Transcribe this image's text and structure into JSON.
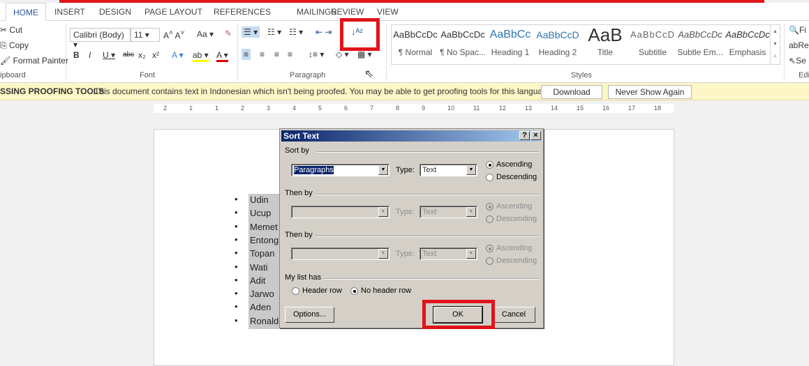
{
  "tabs": [
    "HOME",
    "INSERT",
    "DESIGN",
    "PAGE LAYOUT",
    "REFERENCES",
    "MAILINGS",
    "REVIEW",
    "VIEW"
  ],
  "clipboard": {
    "cut": "Cut",
    "copy": "Copy",
    "format_painter": "Format Painter",
    "group": "ipboard"
  },
  "font": {
    "name": "Calibri (Body)",
    "size": "11",
    "group": "Font",
    "case": "Aa"
  },
  "paragraph": {
    "group": "Paragraph",
    "sort_icon": "A-Z sort"
  },
  "styles": {
    "group": "Styles",
    "items": [
      {
        "preview": "AaBbCcDc",
        "name": "¶ Normal"
      },
      {
        "preview": "AaBbCcDc",
        "name": "¶ No Spac..."
      },
      {
        "preview": "AaBbCc",
        "name": "Heading 1"
      },
      {
        "preview": "AaBbCcD",
        "name": "Heading 2"
      },
      {
        "preview": "AaB",
        "name": "Title"
      },
      {
        "preview": "AaBbCcD",
        "name": "Subtitle"
      },
      {
        "preview": "AaBbCcDc",
        "name": "Subtle Em..."
      },
      {
        "preview": "AaBbCcDc",
        "name": "Emphasis"
      }
    ]
  },
  "editing": {
    "find": "Fi",
    "replace": "Re",
    "select": "Se",
    "group": "Edi"
  },
  "message_bar": {
    "title": "SSING PROOFING TOOLS",
    "text": "This document contains text in Indonesian which isn't being proofed. You may be able to get proofing tools for this language.",
    "download": "Download",
    "never": "Never Show Again"
  },
  "ruler": [
    "2",
    "1",
    "1",
    "2",
    "3",
    "4",
    "5",
    "6",
    "7",
    "8",
    "9",
    "10",
    "11",
    "12",
    "13",
    "14",
    "15",
    "16",
    "17",
    "18"
  ],
  "list": [
    "Udin",
    "Ucup",
    "Memet",
    "Entong",
    "Topan",
    "Wati",
    "Adit",
    "Jarwo",
    "Aden",
    "Ronaldo"
  ],
  "dialog": {
    "title": "Sort Text",
    "help": "?",
    "close": "×",
    "sort_by": "Sort by",
    "sort_by_value": "Paragraphs",
    "type_label": "Type:",
    "type_value": "Text",
    "ascending": "Ascending",
    "descending": "Descending",
    "then_by_1": "Then by",
    "then_by_2": "Then by",
    "then_type_1": "Text",
    "then_type_2": "Text",
    "my_list_has": "My list has",
    "header_row": "Header row",
    "no_header_row": "No header row",
    "options": "Options...",
    "ok": "OK",
    "cancel": "Cancel"
  },
  "colors": {
    "accent": "#2b579a",
    "highlight": "#e0141b",
    "dialog_bg": "#d4d0c8"
  }
}
